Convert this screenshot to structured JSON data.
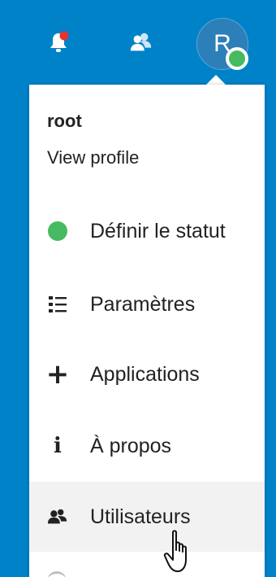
{
  "header": {
    "icons": [
      "notifications-bell-icon",
      "contacts-icon"
    ],
    "avatar": {
      "initial": "R",
      "status_color": "#46ba61"
    },
    "accent_color": "#0082c9"
  },
  "profile": {
    "name": "root",
    "subtitle": "View profile"
  },
  "menu": {
    "items": [
      {
        "label": "Définir le statut",
        "icon": "status-dot-icon"
      },
      {
        "label": "Paramètres",
        "icon": "settings-list-icon"
      },
      {
        "label": "Applications",
        "icon": "plus-icon"
      },
      {
        "label": "À propos",
        "icon": "info-icon"
      },
      {
        "label": "Utilisateurs",
        "icon": "users-icon"
      }
    ],
    "hovered_item": "Utilisateurs"
  }
}
